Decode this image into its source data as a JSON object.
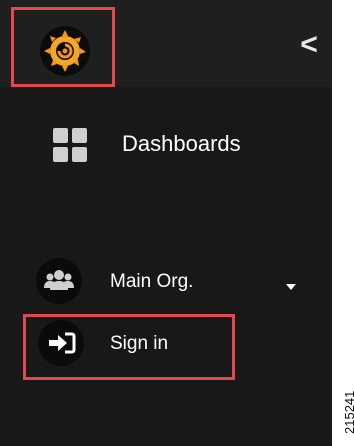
{
  "sidebar": {
    "logo": {
      "icon": "grafana-logo-icon"
    },
    "collapse": {
      "icon": "chevron-left-icon",
      "glyph": "<"
    },
    "items": [
      {
        "id": "dashboards",
        "label": "Dashboards",
        "icon": "dashboards-grid-icon"
      }
    ],
    "org": {
      "label": "Main Org.",
      "icon": "users-group-icon",
      "dropdown_icon": "caret-down-icon"
    },
    "signin": {
      "label": "Sign in",
      "icon": "sign-in-icon"
    }
  },
  "figure_number": "215241",
  "colors": {
    "highlight": "#e0494f",
    "panel": "#181818",
    "header": "#1f1f1f",
    "logo_orange": "#f7931e"
  }
}
